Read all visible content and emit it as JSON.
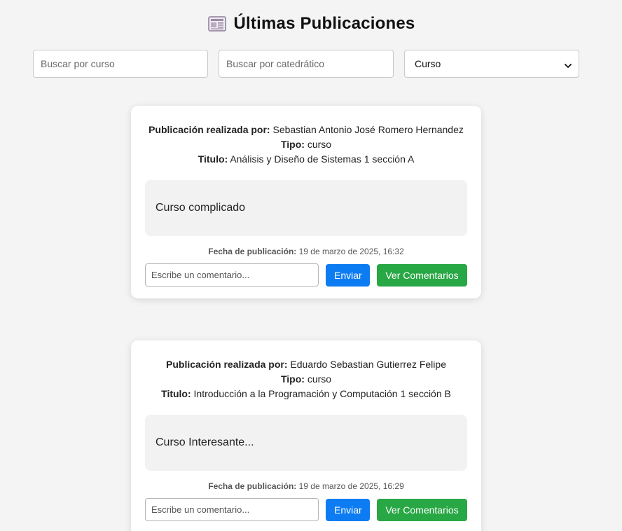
{
  "header": {
    "title": "Últimas Publicaciones",
    "icon": "newspaper-icon"
  },
  "filters": {
    "course_placeholder": "Buscar por curso",
    "professor_placeholder": "Buscar por catedrático",
    "select_value": "Curso"
  },
  "labels": {
    "author": "Publicación realizada por:",
    "type": "Tipo:",
    "title": "Titulo:",
    "date": "Fecha de publicación:",
    "comment_placeholder": "Escribe un comentario...",
    "send": "Enviar",
    "view_comments": "Ver Comentarios"
  },
  "posts": [
    {
      "author": "Sebastian Antonio José Romero Hernandez",
      "type": "curso",
      "title": "Análisis y Diseño de Sistemas 1 sección A",
      "content": "Curso complicado",
      "date": "19 de marzo de 2025, 16:32"
    },
    {
      "author": "Eduardo Sebastian Gutierrez Felipe",
      "type": "curso",
      "title": "Introducción a la Programación y Computación 1 sección B",
      "content": "Curso Interesante...",
      "date": "19 de marzo de 2025, 16:29"
    }
  ],
  "colors": {
    "background": "#f3f4f3",
    "send_button": "#0d7cf2",
    "view_button": "#28a745"
  }
}
